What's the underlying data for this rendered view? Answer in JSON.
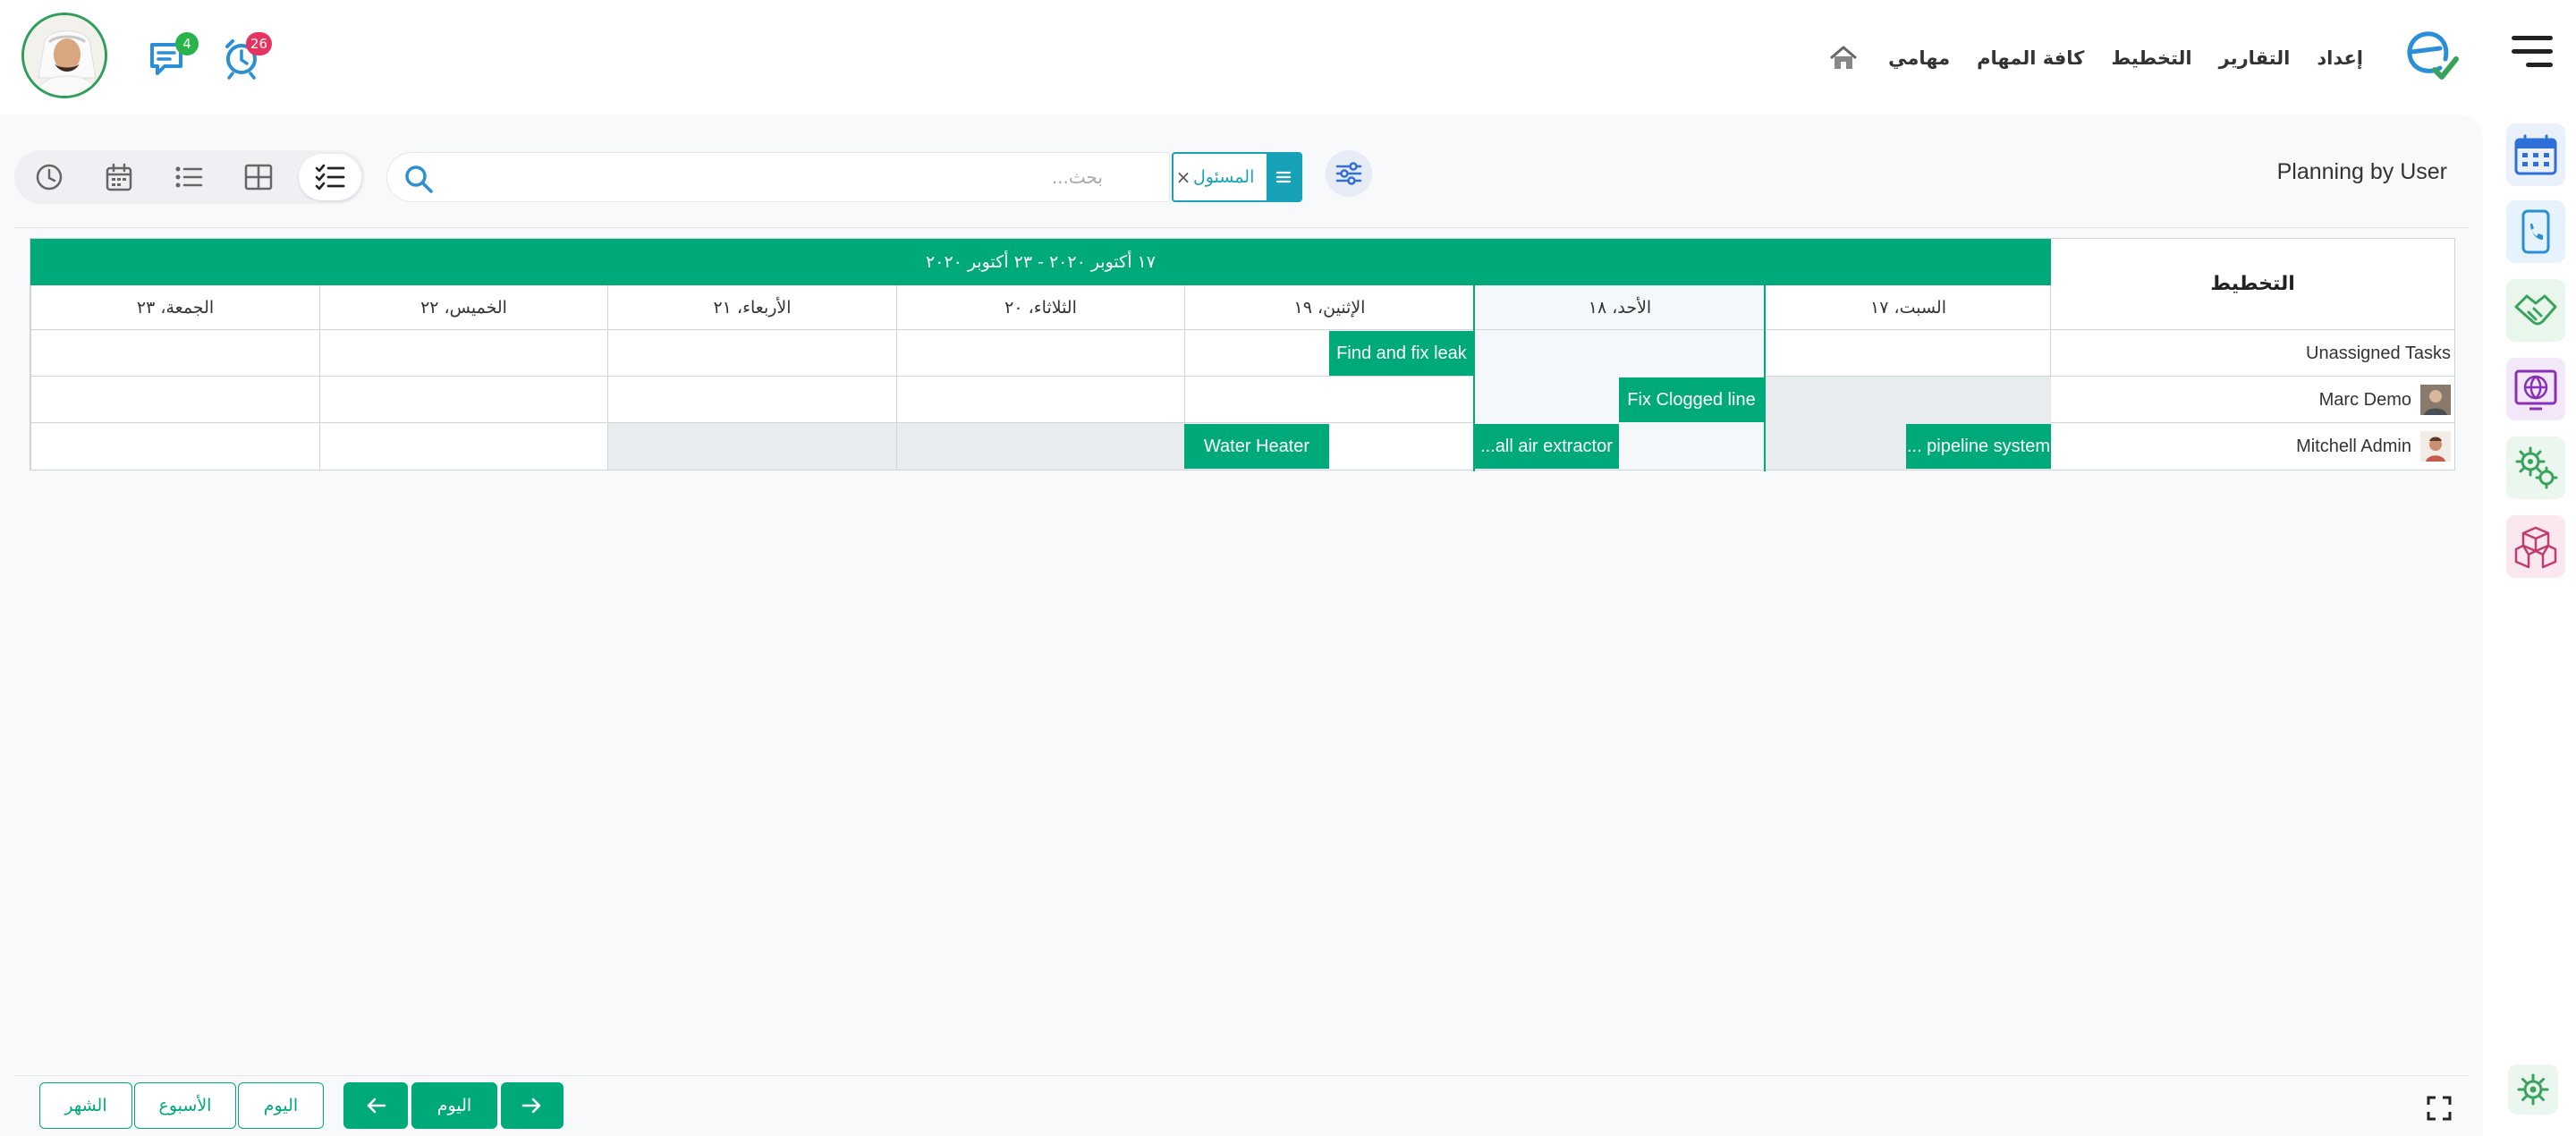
{
  "header": {
    "nav": [
      {
        "key": "tasks",
        "label": "مهامي"
      },
      {
        "key": "all_tasks",
        "label": "كافة المهام"
      },
      {
        "key": "planning",
        "label": "التخطيط"
      },
      {
        "key": "reports",
        "label": "التقارير"
      },
      {
        "key": "settings",
        "label": "إعداد"
      }
    ],
    "messages_count": "4",
    "activity_count": "26",
    "icons": {
      "menu": "hamburger-icon",
      "home": "home-icon",
      "messages": "chat-icon",
      "activity": "alarm-clock-icon"
    }
  },
  "rail": {
    "apps": [
      {
        "name": "calendar-icon",
        "color": "#2e6fd8",
        "bg": "#eaf1fc"
      },
      {
        "name": "phone-icon",
        "color": "#2a8fd6",
        "bg": "#e6f3fc"
      },
      {
        "name": "handshake-icon",
        "color": "#3aa35b",
        "bg": "#e8f6ec"
      },
      {
        "name": "globe-icon",
        "color": "#8a2fb8",
        "bg": "#f3e8fa"
      },
      {
        "name": "gears-icon",
        "color": "#3aa35b",
        "bg": "#eaf6ee"
      },
      {
        "name": "boxes-icon",
        "color": "#c23a6e",
        "bg": "#fbe8ef"
      }
    ],
    "settings_icon": "settings-cog-icon"
  },
  "control_panel": {
    "title": "Planning by User",
    "facet_label": "المسئول",
    "facet_remove": "×",
    "search_placeholder": "بحث..."
  },
  "views": [
    {
      "name": "gantt-view-icon",
      "active": true
    },
    {
      "name": "kanban-view-icon",
      "active": false
    },
    {
      "name": "list-view-icon",
      "active": false
    },
    {
      "name": "calendar-view-icon",
      "active": false
    },
    {
      "name": "activity-view-icon",
      "active": false
    }
  ],
  "gantt": {
    "header_label": "التخطيط",
    "range_label": "١٧ أكتوبر ٢٠٢٠ - ٢٣ أكتوبر ٢٠٢٠",
    "days": [
      "السبت، ١٧",
      "الأحد، ١٨",
      "الإثنين، ١٩",
      "الثلاثاء، ٢٠",
      "الأربعاء، ٢١",
      "الخميس، ٢٢",
      "الجمعة، ٢٣"
    ],
    "rows": [
      {
        "name": "Unassigned Tasks"
      },
      {
        "name": "Marc Demo"
      },
      {
        "name": "Mitchell Admin"
      }
    ],
    "tasks": {
      "find_leak": "Find and fix leak",
      "clogged": "Fix Clogged line",
      "water_heater": "Water Heater",
      "air_extractor": "...all air extractor",
      "pipeline": "... pipeline system"
    }
  },
  "footer": {
    "today": "اليوم",
    "scale_day": "اليوم",
    "scale_week": "الأسبوع",
    "scale_month": "الشهر",
    "prev": "←",
    "next": "→"
  },
  "colors": {
    "primary": "#00a97a",
    "facet": "#17a2b8",
    "badge_messages": "#28b44a",
    "badge_activity": "#e6335f"
  }
}
